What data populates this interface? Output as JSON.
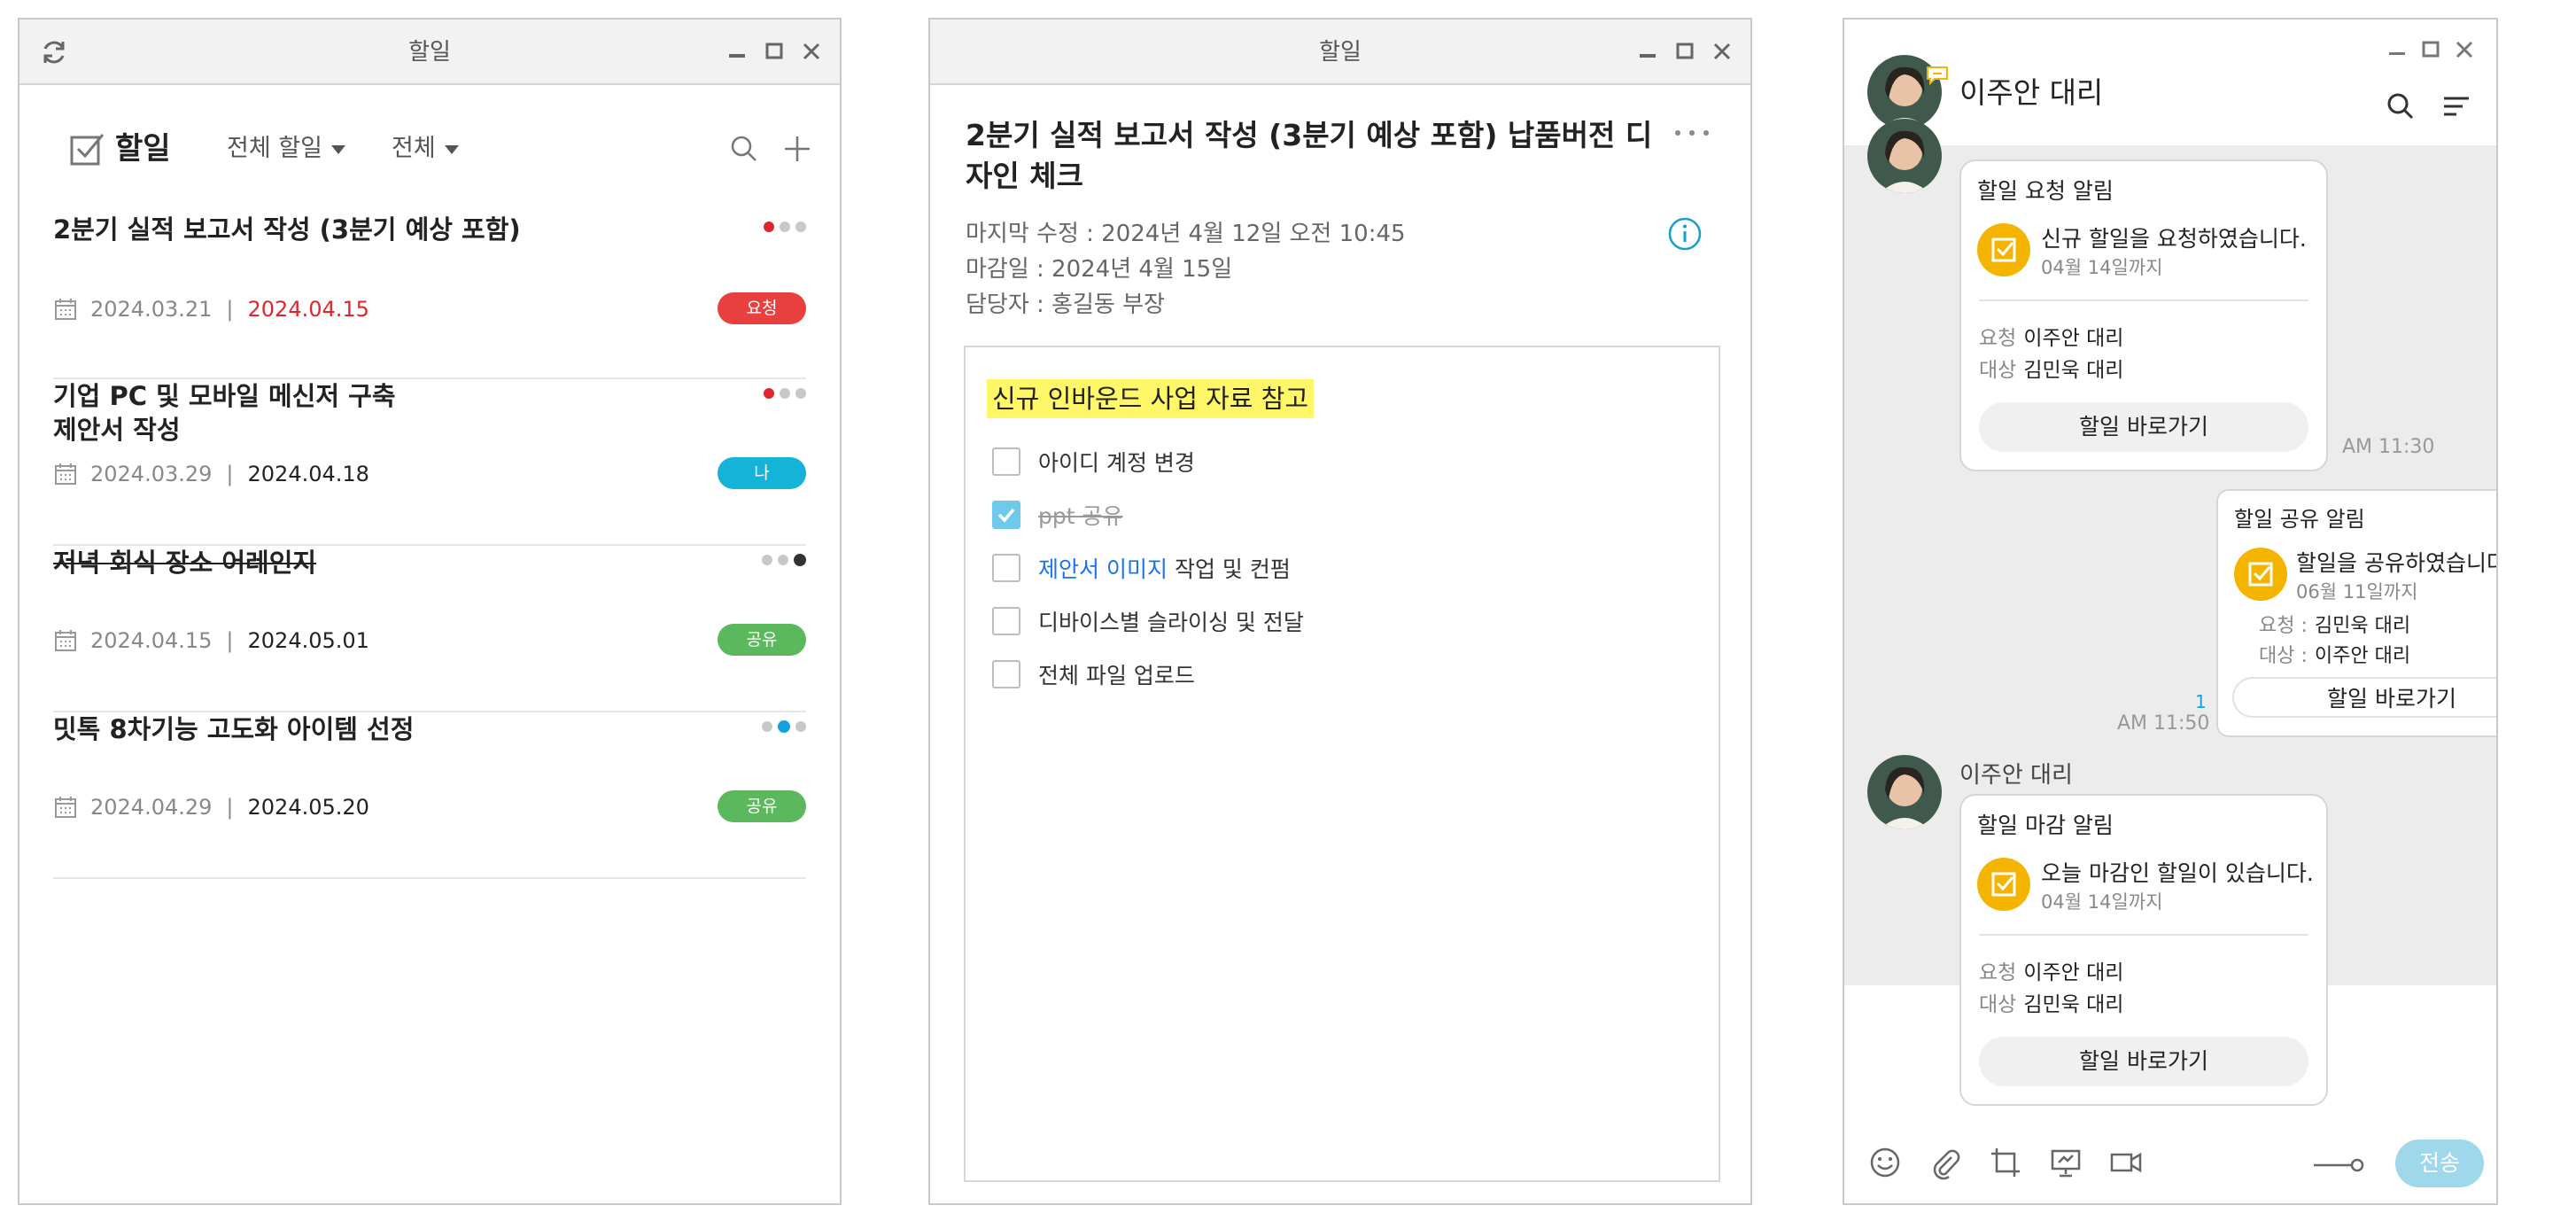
{
  "todo_list_window": {
    "title": "할일",
    "header_title": "할일",
    "filter_all_todo": "전체 할일",
    "filter_all": "전체",
    "items": [
      {
        "title": "2분기 실적 보고서 작성 (3분기 예상 포함)",
        "start": "2024.03.21",
        "due": "2024.04.15",
        "badge": "요청",
        "separator": "|"
      },
      {
        "title": "기업 PC 및 모바일 메신저 구축\n제안서 작성",
        "start": "2024.03.29",
        "due": "2024.04.18",
        "badge": "나",
        "separator": "|"
      },
      {
        "title": "저녁 회식 장소 어레인지",
        "start": "2024.04.15",
        "due": "2024.05.01",
        "badge": "공유",
        "separator": "|"
      },
      {
        "title": "밋톡 8차기능 고도화 아이템 선정",
        "start": "2024.04.29",
        "due": "2024.05.20",
        "badge": "공유",
        "separator": "|"
      }
    ]
  },
  "todo_detail_window": {
    "title": "할일",
    "task_title": "2분기 실적 보고서 작성 (3분기 예상 포함) 납품버전 디자인 체크",
    "last_modified": "마지막 수정 : 2024년 4월 12일 오전 10:45",
    "due": "마감일 : 2024년 4월 15일",
    "assignee": "담당자 : 홍길동 부장",
    "highlight": "신규 인바운드 사업 자료 참고",
    "checklist": [
      {
        "label": "아이디 계정 변경",
        "checked": false
      },
      {
        "label": "ppt 공유",
        "checked": true
      },
      {
        "link": "제안서 이미지",
        "label": "작업 및 컨펌",
        "checked": false
      },
      {
        "label": "디바이스별 슬라이싱 및 전달",
        "checked": false
      },
      {
        "label": "전체 파일 업로드",
        "checked": false
      }
    ]
  },
  "chat_window": {
    "contact_name": "이주안 대리",
    "messages": [
      {
        "title": "할일 요청 알림",
        "text": "신규 할일을 요청하였습니다.",
        "until": "04월 14일까지",
        "req_key": "요청",
        "req_val": "이주안 대리",
        "tgt_key": "대상",
        "tgt_val": "김민욱 대리",
        "button": "할일 바로가기",
        "time": "AM 11:30"
      },
      {
        "title": "할일 공유 알림",
        "text": "할일을 공유하였습니다",
        "until": "06월 11일까지",
        "req_key": "요청 :",
        "req_val": "김민욱 대리",
        "tgt_key": "대상 :",
        "tgt_val": "이주안 대리",
        "button": "할일 바로가기",
        "time": "AM 11:50",
        "unread": "1"
      },
      {
        "sender": "이주안 대리",
        "title": "할일 마감 알림",
        "text": "오늘 마감인 할일이 있습니다.",
        "until": "04월 14일까지",
        "req_key": "요청",
        "req_val": "이주안 대리",
        "tgt_key": "대상",
        "tgt_val": "김민욱 대리",
        "button": "할일 바로가기"
      }
    ],
    "send_label": "전송"
  },
  "colors": {
    "badge_request": "#e8403f",
    "badge_me": "#16b3d9",
    "badge_share": "#5cb85c",
    "accent": "#f5b400"
  }
}
